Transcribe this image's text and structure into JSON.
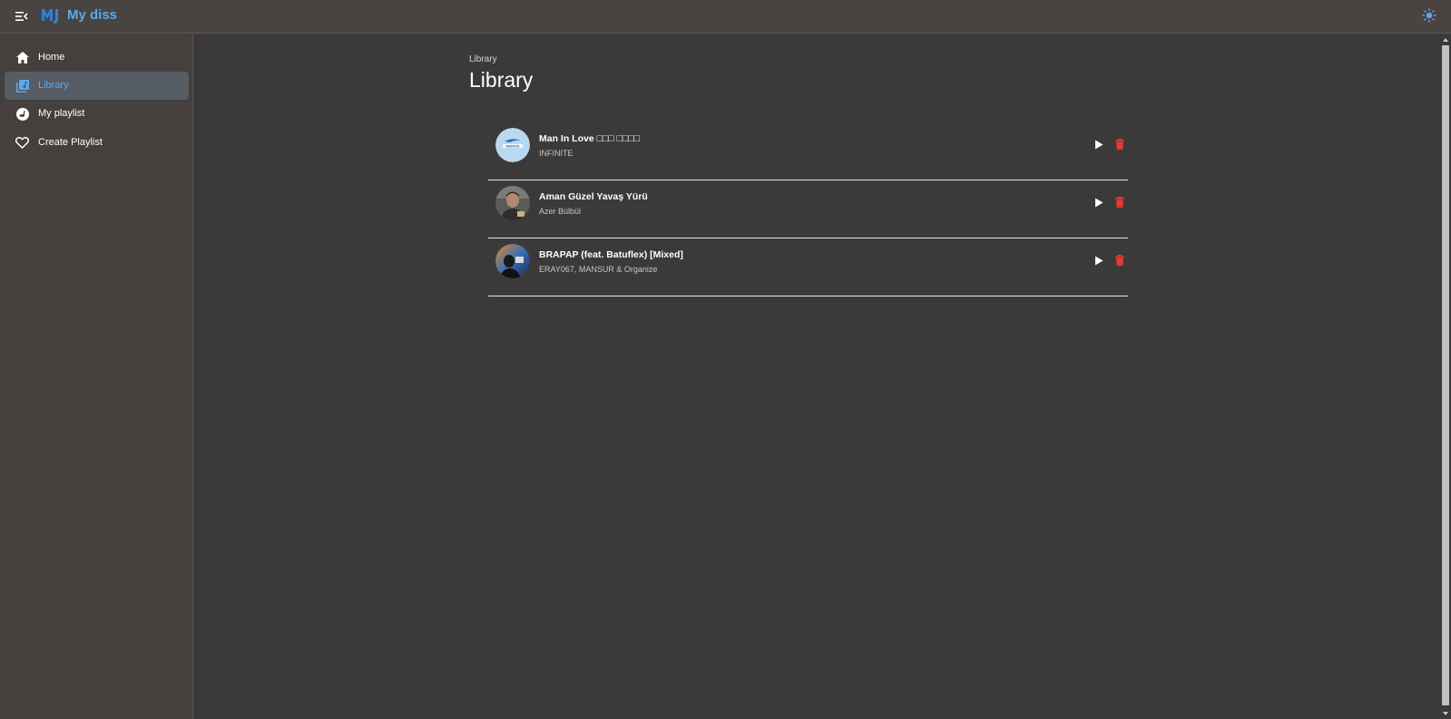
{
  "app": {
    "title": "My diss",
    "accent_color": "#5aa9f0"
  },
  "sidebar": {
    "items": [
      {
        "label": "Home",
        "icon": "home-icon",
        "active": false
      },
      {
        "label": "Library",
        "icon": "library-music-icon",
        "active": true
      },
      {
        "label": "My playlist",
        "icon": "album-icon",
        "active": false
      },
      {
        "label": "Create Playlist",
        "icon": "heart-outline-icon",
        "active": false
      }
    ]
  },
  "main": {
    "breadcrumb": "Library",
    "title": "Library"
  },
  "tracks": [
    {
      "title": "Man In Love □□□ □□□□",
      "artist": "INFINITE",
      "thumb": "infinite-logo-thumbnail"
    },
    {
      "title": "Aman Güzel Yavaş Yürü",
      "artist": "Azer Bülbül",
      "thumb": "artist-photo-thumbnail"
    },
    {
      "title": "BRAPAP (feat. Batuflex) [Mixed]",
      "artist": "ERAY067, MANSUR & Organize",
      "thumb": "album-art-thumbnail"
    }
  ],
  "colors": {
    "delete": "#e53935",
    "background": "#3c3a39",
    "sidebar": "#45403d",
    "topbar": "#494441"
  }
}
